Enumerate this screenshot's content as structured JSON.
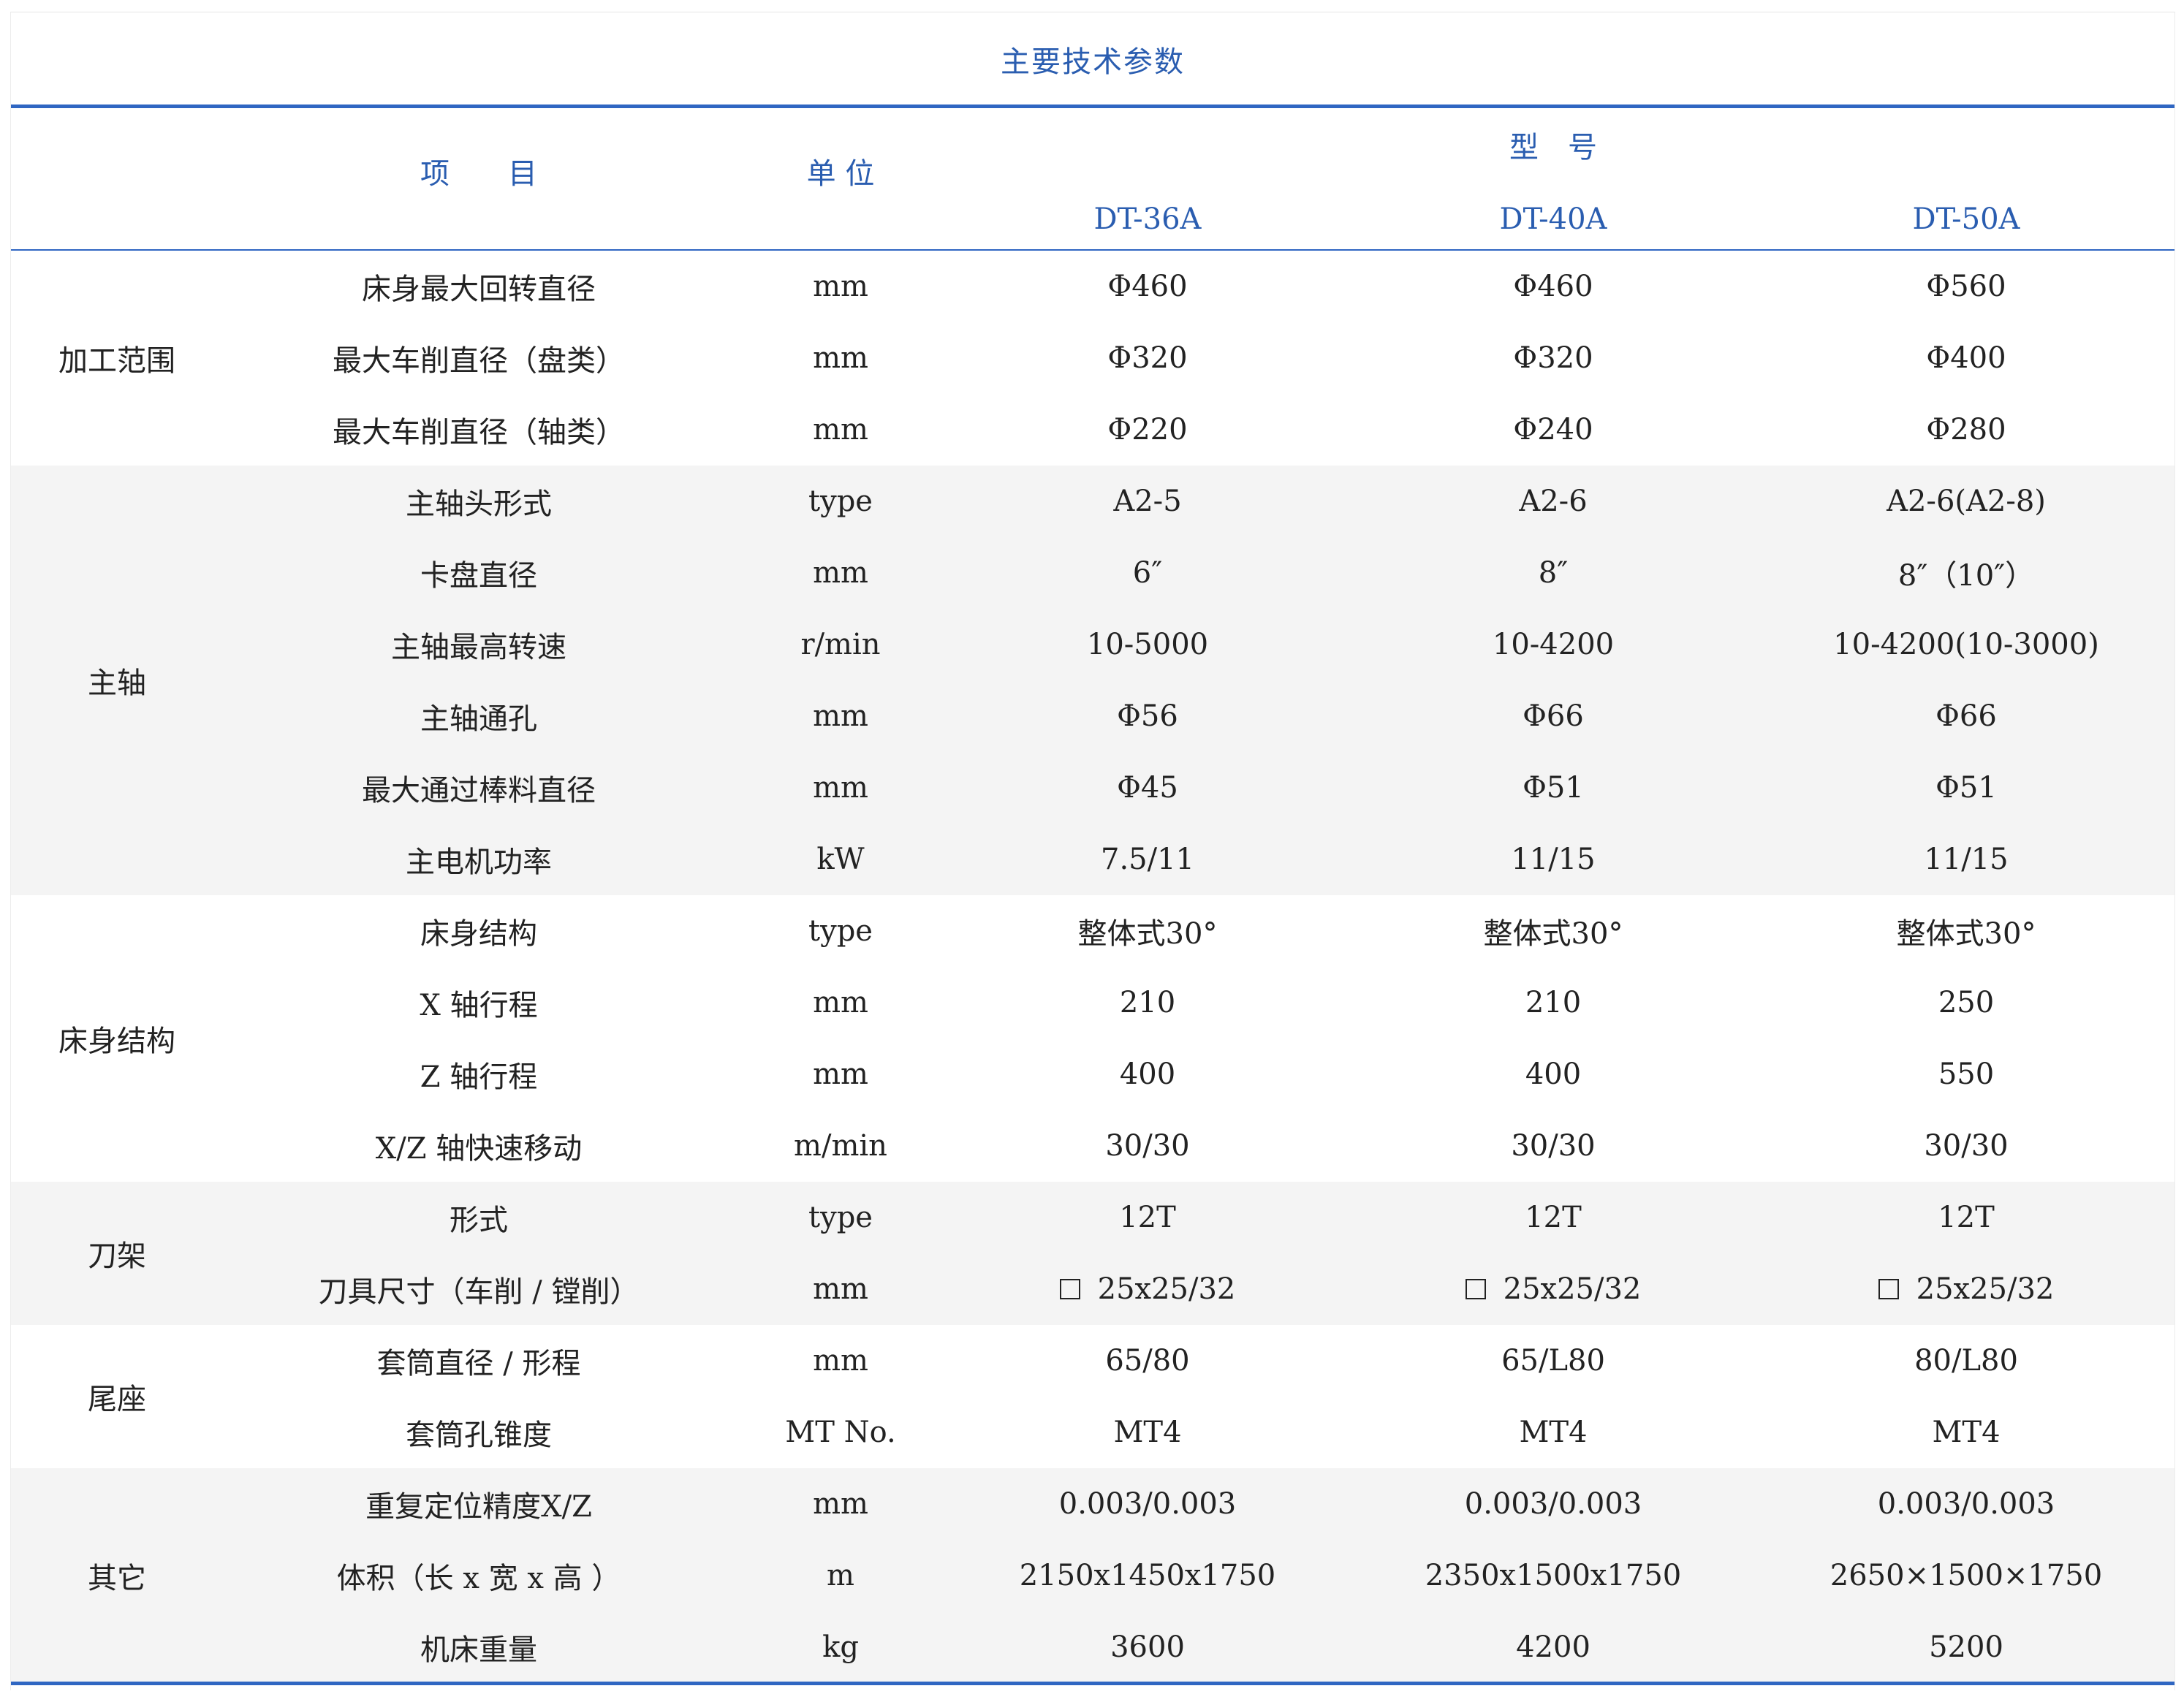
{
  "title": "主要技术参数",
  "header": {
    "item": "项　　目",
    "unit": "单 位",
    "model": "型　号",
    "models": [
      "DT-36A",
      "DT-40A",
      "DT-50A"
    ]
  },
  "groups": [
    {
      "name": "加工范围",
      "shaded": false,
      "rows": [
        {
          "item": "床身最大回转直径",
          "unit": "mm",
          "values": [
            "Φ460",
            "Φ460",
            "Φ560"
          ]
        },
        {
          "item": "最大车削直径（盘类）",
          "unit": "mm",
          "values": [
            "Φ320",
            "Φ320",
            "Φ400"
          ]
        },
        {
          "item": "最大车削直径（轴类）",
          "unit": "mm",
          "values": [
            "Φ220",
            "Φ240",
            "Φ280"
          ]
        }
      ]
    },
    {
      "name": "主轴",
      "shaded": true,
      "rows": [
        {
          "item": "主轴头形式",
          "unit": "type",
          "values": [
            "A2-5",
            "A2-6",
            "A2-6(A2-8)"
          ]
        },
        {
          "item": "卡盘直径",
          "unit": "mm",
          "values": [
            "6″",
            "8″",
            "8″（10″）"
          ]
        },
        {
          "item": "主轴最高转速",
          "unit": "r/min",
          "values": [
            "10-5000",
            "10-4200",
            "10-4200(10-3000)"
          ]
        },
        {
          "item": "主轴通孔",
          "unit": "mm",
          "values": [
            "Φ56",
            "Φ66",
            "Φ66"
          ]
        },
        {
          "item": "最大通过棒料直径",
          "unit": "mm",
          "values": [
            "Φ45",
            "Φ51",
            "Φ51"
          ]
        },
        {
          "item": "主电机功率",
          "unit": "kW",
          "values": [
            "7.5/11",
            "11/15",
            "11/15"
          ]
        }
      ]
    },
    {
      "name": "床身结构",
      "shaded": false,
      "rows": [
        {
          "item": "床身结构",
          "unit": "type",
          "values": [
            "整体式30°",
            "整体式30°",
            "整体式30°"
          ]
        },
        {
          "item": "X 轴行程",
          "unit": "mm",
          "values": [
            "210",
            "210",
            "250"
          ]
        },
        {
          "item": "Z 轴行程",
          "unit": "mm",
          "values": [
            "400",
            "400",
            "550"
          ]
        },
        {
          "item": "X/Z 轴快速移动",
          "unit": "m/min",
          "values": [
            "30/30",
            "30/30",
            "30/30"
          ]
        }
      ]
    },
    {
      "name": "刀架",
      "shaded": true,
      "rows": [
        {
          "item": "形式",
          "unit": "type",
          "values": [
            "12T",
            "12T",
            "12T"
          ]
        },
        {
          "item": "刀具尺寸（车削 / 镗削）",
          "unit": "mm",
          "values": [
            "25x25/32",
            "25x25/32",
            "25x25/32"
          ],
          "square": true
        }
      ]
    },
    {
      "name": "尾座",
      "shaded": false,
      "rows": [
        {
          "item": "套筒直径 / 形程",
          "unit": "mm",
          "values": [
            "65/80",
            "65/L80",
            "80/L80"
          ]
        },
        {
          "item": "套筒孔锥度",
          "unit": "MT No.",
          "values": [
            "MT4",
            "MT4",
            "MT4"
          ]
        }
      ]
    },
    {
      "name": "其它",
      "shaded": true,
      "rows": [
        {
          "item": "重复定位精度X/Z",
          "unit": "mm",
          "values": [
            "0.003/0.003",
            "0.003/0.003",
            "0.003/0.003"
          ]
        },
        {
          "item": "体积（长 x 宽 x 高 ）",
          "unit": "m",
          "values": [
            "2150x1450x1750",
            "2350x1500x1750",
            "2650×1500×1750"
          ]
        },
        {
          "item": "机床重量",
          "unit": "kg",
          "values": [
            "3600",
            "4200",
            "5200"
          ]
        }
      ]
    }
  ]
}
